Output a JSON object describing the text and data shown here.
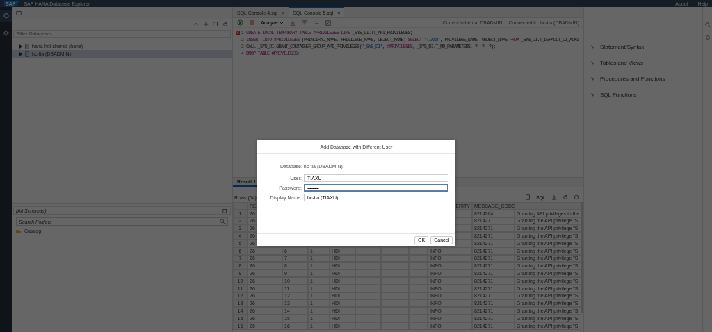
{
  "shell": {
    "title": "SAP HANA Database Explorer",
    "logo": "SAP",
    "links": [
      "About",
      "Help"
    ]
  },
  "database_panel": {
    "filter_placeholder": "Filter Databases",
    "databases": [
      {
        "label": "hana-hdi-shared (hana)",
        "selected": false,
        "expanded": false
      },
      {
        "label": "hc-tia (DBADMIN)",
        "selected": true,
        "expanded": false
      }
    ]
  },
  "catalog_panel": {
    "schema": "(All Schemas)",
    "search_placeholder": "Search Folders",
    "items": [
      "Catalog"
    ]
  },
  "editor": {
    "tabs": [
      {
        "label": "SQL Console 4.sql",
        "close": "×",
        "selected": false
      },
      {
        "label": "SQL Console 5.sql",
        "close": "×",
        "selected": true
      }
    ],
    "analyze": "Analyze",
    "current_schema": "Current schema: DBADMIN",
    "connected": "Connected to: hc-tia (DBADMIN)",
    "lines": [
      {
        "number": "1",
        "error": true,
        "tokens": [
          {
            "kind": "keyword",
            "text": "CREATE LOCAL TEMPORARY TABLE #PRIVILEGES LIKE "
          },
          {
            "kind": "plain",
            "text": "_SYS_DI.TT_API_PRIVILEGES;"
          }
        ]
      },
      {
        "number": "2",
        "error": false,
        "tokens": [
          {
            "kind": "keyword",
            "text": "INSERT INTO #PRIVILEGES "
          },
          {
            "kind": "plain",
            "text": "(PRINCIPAL_NAME, PRIVILEGE_NAME, OBJECT_NAME) "
          },
          {
            "kind": "keyword",
            "text": "SELECT "
          },
          {
            "kind": "string",
            "text": "'TIAXU'"
          },
          {
            "kind": "plain",
            "text": ", PRIVILEGE_NAME, OBJECT_NAME "
          },
          {
            "kind": "keyword",
            "text": "FROM "
          },
          {
            "kind": "plain",
            "text": "_SYS_DI.T_DEFAULT_DI_ADMI"
          }
        ]
      },
      {
        "number": "3",
        "error": false,
        "tokens": [
          {
            "kind": "plain",
            "text": "CALL _SYS_DI.GRANT_CONTAINER_GROUP_API_PRIVILEGES("
          },
          {
            "kind": "string",
            "text": "'_SYS_DI'"
          },
          {
            "kind": "plain",
            "text": ", "
          },
          {
            "kind": "keyword",
            "text": "#PRIVILEGES"
          },
          {
            "kind": "plain",
            "text": ", _SYS_DI.T_NO_PARAMETERS, ?, ?, ?);"
          }
        ]
      },
      {
        "number": "4",
        "error": false,
        "tokens": [
          {
            "kind": "keyword",
            "text": "DROP TABLE #PRIVILEGES"
          },
          {
            "kind": "plain",
            "text": ";"
          }
        ]
      }
    ]
  },
  "side_panel": {
    "items": [
      "Statement/Syntax",
      "Tables and Views",
      "Procedures and Functions",
      "SQL Functions"
    ]
  },
  "results": {
    "tabs": [
      {
        "label": "Result 1",
        "selected": true
      }
    ],
    "rows_label": "Rows (64)",
    "sql_button": "SQL",
    "columns": [
      "RE",
      null,
      null,
      null,
      null,
      null,
      null,
      "ERITY",
      "MESSAGE_CODE",
      null
    ],
    "rows": [
      {
        "number": "1",
        "cells": [
          "26",
          null,
          null,
          null,
          null,
          null,
          null,
          null,
          "8214264",
          "Granting API privileges in the"
        ]
      },
      {
        "number": "2",
        "cells": [
          "26",
          null,
          null,
          null,
          null,
          null,
          null,
          null,
          "8214271",
          "Granting the API privilege \"S"
        ]
      },
      {
        "number": "3",
        "cells": [
          "26",
          null,
          null,
          null,
          null,
          null,
          null,
          null,
          "8214271",
          "Granting the API privilege \"S"
        ]
      },
      {
        "number": "4",
        "cells": [
          "26",
          null,
          null,
          null,
          null,
          null,
          null,
          null,
          "8214271",
          "Granting the API privilege \"S"
        ]
      },
      {
        "number": "5",
        "cells": [
          "26",
          null,
          null,
          null,
          null,
          null,
          null,
          null,
          "8214271",
          "Granting the API privilege \"S"
        ]
      },
      {
        "number": "6",
        "cells": [
          "26",
          "6",
          "1",
          "HDI",
          null,
          null,
          null,
          "INFO",
          "8214271",
          "Granting the API privilege \"S"
        ]
      },
      {
        "number": "7",
        "cells": [
          "26",
          "7",
          "1",
          "HDI",
          null,
          null,
          null,
          "INFO",
          "8214271",
          "Granting the API privilege \"S"
        ]
      },
      {
        "number": "8",
        "cells": [
          "26",
          "8",
          "1",
          "HDI",
          null,
          null,
          null,
          "INFO",
          "8214271",
          "Granting the API privilege \"S"
        ]
      },
      {
        "number": "9",
        "cells": [
          "26",
          "9",
          "1",
          "HDI",
          null,
          null,
          null,
          "INFO",
          "8214271",
          "Granting the API privilege \"S"
        ]
      },
      {
        "number": "10",
        "cells": [
          "26",
          "10",
          "1",
          "HDI",
          null,
          null,
          null,
          "INFO",
          "8214271",
          "Granting the API privilege \"S"
        ]
      },
      {
        "number": "11",
        "cells": [
          "26",
          "11",
          "1",
          "HDI",
          null,
          null,
          null,
          "INFO",
          "8214271",
          "Granting the API privilege \"S"
        ]
      },
      {
        "number": "12",
        "cells": [
          "26",
          "12",
          "1",
          "HDI",
          null,
          null,
          null,
          "INFO",
          "8214271",
          "Granting the API privilege \"S"
        ]
      },
      {
        "number": "13",
        "cells": [
          "26",
          "13",
          "1",
          "HDI",
          null,
          null,
          null,
          "INFO",
          "8214271",
          "Granting the API privilege \"S"
        ]
      },
      {
        "number": "14",
        "cells": [
          "26",
          "14",
          "1",
          "HDI",
          null,
          null,
          null,
          "INFO",
          "8214271",
          "Granting the API privilege \"S"
        ]
      },
      {
        "number": "15",
        "cells": [
          "26",
          "15",
          "1",
          "HDI",
          null,
          null,
          null,
          "INFO",
          "8214271",
          "Granting the API privilege \"S"
        ]
      },
      {
        "number": "16",
        "cells": [
          "26",
          "16",
          "1",
          "HDI",
          null,
          null,
          null,
          "INFO",
          "8214271",
          "Granting the API privilege \"S"
        ]
      }
    ]
  },
  "dialog": {
    "title": "Add Database with Different User",
    "database": "Database: hc-tia (DBADMIN)",
    "fields": [
      {
        "label": "User:",
        "value": "TIAXU",
        "kind": "text",
        "focused": false
      },
      {
        "label": "Password:",
        "value": "•••••••••••",
        "kind": "password",
        "focused": true
      },
      {
        "label": "Display Name:",
        "value": "hc-tia (TIAXU)",
        "kind": "text",
        "focused": false
      }
    ],
    "buttons": [
      "OK",
      "Cancel"
    ]
  }
}
